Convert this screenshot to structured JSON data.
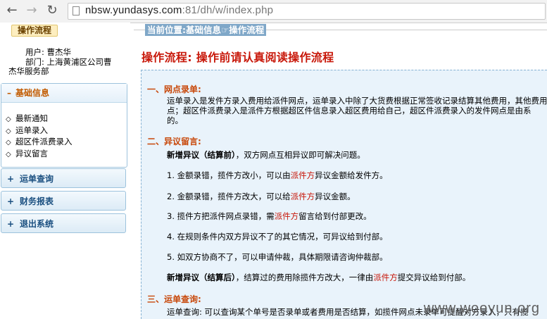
{
  "browser": {
    "url_main": "nbsw.yundasys.com",
    "url_rest": ":81/dh/w/index.php"
  },
  "sidebar": {
    "flow_tab": "操作流程",
    "user_line": "用户: 曹杰华",
    "dept_line1": "部门: 上海黄浦区公司曹",
    "dept_line2": "杰华服务部",
    "menus": [
      {
        "label": "基础信息",
        "state": "expanded",
        "icon": "minus-icon",
        "items": [
          "最新通知",
          "运单录入",
          "超区件派费录入",
          "异议留言"
        ]
      },
      {
        "label": "运单查询",
        "state": "collapsed",
        "icon": "plus-icon"
      },
      {
        "label": "财务报表",
        "state": "collapsed",
        "icon": "plus-icon"
      },
      {
        "label": "退出系统",
        "state": "collapsed",
        "icon": "plus-icon"
      }
    ]
  },
  "main": {
    "breadcrumb": "当前位置:基础信息☞操作流程",
    "title": "操作流程: 操作前请认真阅读操作流程",
    "sections": {
      "s1_heading": "一、网点录单:",
      "s1_line1": "运单录入是发件方录入费用给派件网点，运单录入中除了大货费根据正常签收记录结算其他费用，其他费用",
      "s1_line2": "点；超区件派费录入是派件方根据超区件信息录入超区费用给自己，超区件派费录入的发件网点是由系",
      "s1_line3": "的。",
      "s2_heading": "二、异议留言:",
      "s2_new_before_bold": "新增异议（结算前）",
      "s2_new_before_rest": "，双方网点互相异议即可解决问题。",
      "s2_item1_a": "1. 金额录错，揽件方改小，可以由",
      "s2_item1_red": "派件方",
      "s2_item1_b": "异议金额给发件方。",
      "s2_item2_a": "2. 金额录错，揽件方改大，可以给",
      "s2_item2_red": "派件方",
      "s2_item2_b": "异议金额。",
      "s2_item3_a": "3. 揽件方把派件网点录错，需",
      "s2_item3_red": "派件方",
      "s2_item3_b": "留言给到付部更改。",
      "s2_item4": "4. 在规则条件内双方异议不了的其它情况，可异议给到付部。",
      "s2_item5": "5. 如双方协商不了，可以申请仲裁，具体期限请咨询仲裁部。",
      "s2_new_after_bold": "新增异议（结算后）",
      "s2_new_after_a": "，结算过的费用除揽件方改大，一律由",
      "s2_new_after_red": "派件方",
      "s2_new_after_b": "提交异议给到付部。",
      "s3_heading": "三、运单查询:",
      "s3_line1": "运单查询: 可以查询某个单号是否录单或者费用是否结算，如揽件网点未录单可提醒对方录入，只有揽"
    }
  },
  "watermark": "www.wooyun.org",
  "colors": {
    "accent_red": "#c8180a",
    "section_orange": "#c8480a",
    "menu_blue": "#1a4f80",
    "breadcrumb_bg": "#7fa7c8",
    "content_bg": "#e9f3fb"
  }
}
